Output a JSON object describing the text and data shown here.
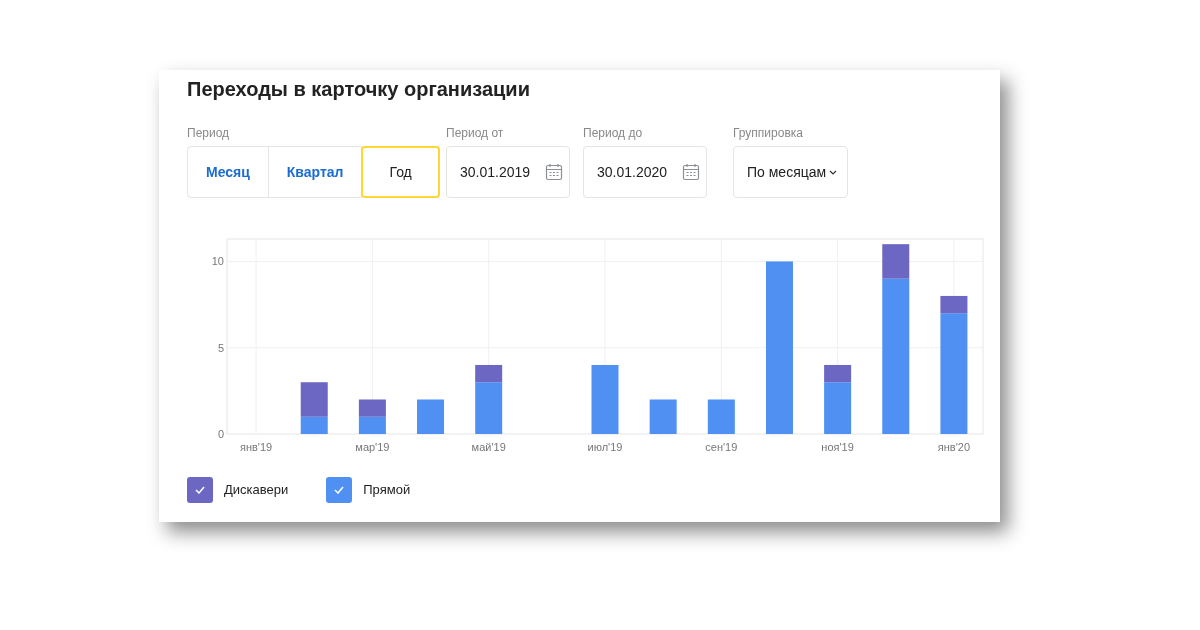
{
  "title": "Переходы в карточку организации",
  "period": {
    "label": "Период",
    "options": [
      {
        "label": "Месяц",
        "selected": false
      },
      {
        "label": "Квартал",
        "selected": false
      },
      {
        "label": "Год",
        "selected": true
      }
    ]
  },
  "date_from": {
    "label": "Период от",
    "value": "30.01.2019"
  },
  "date_to": {
    "label": "Период до",
    "value": "30.01.2020"
  },
  "grouping": {
    "label": "Группировка",
    "value": "По месяцам"
  },
  "chart": {
    "chart_data": {
      "type": "bar",
      "stacked": true,
      "categories": [
        "янв'19",
        null,
        "мар'19",
        null,
        "май'19",
        null,
        "июл'19",
        null,
        "сен'19",
        null,
        "ноя'19",
        null,
        "янв'20"
      ],
      "series": [
        {
          "name": "Дискавери",
          "color": "#6b67c2",
          "values": [
            0,
            2,
            1,
            0,
            1,
            0,
            0,
            0,
            0,
            0,
            1,
            2,
            1
          ]
        },
        {
          "name": "Прямой",
          "color": "#4f90f2",
          "values": [
            0,
            1,
            1,
            2,
            3,
            0,
            4,
            2,
            2,
            10,
            3,
            9,
            7
          ]
        }
      ],
      "yticks": [
        0,
        5,
        10
      ],
      "ylim": [
        0,
        11.3
      ],
      "grid": true
    },
    "legend": [
      {
        "checked": true
      },
      {
        "checked": true
      }
    ]
  }
}
